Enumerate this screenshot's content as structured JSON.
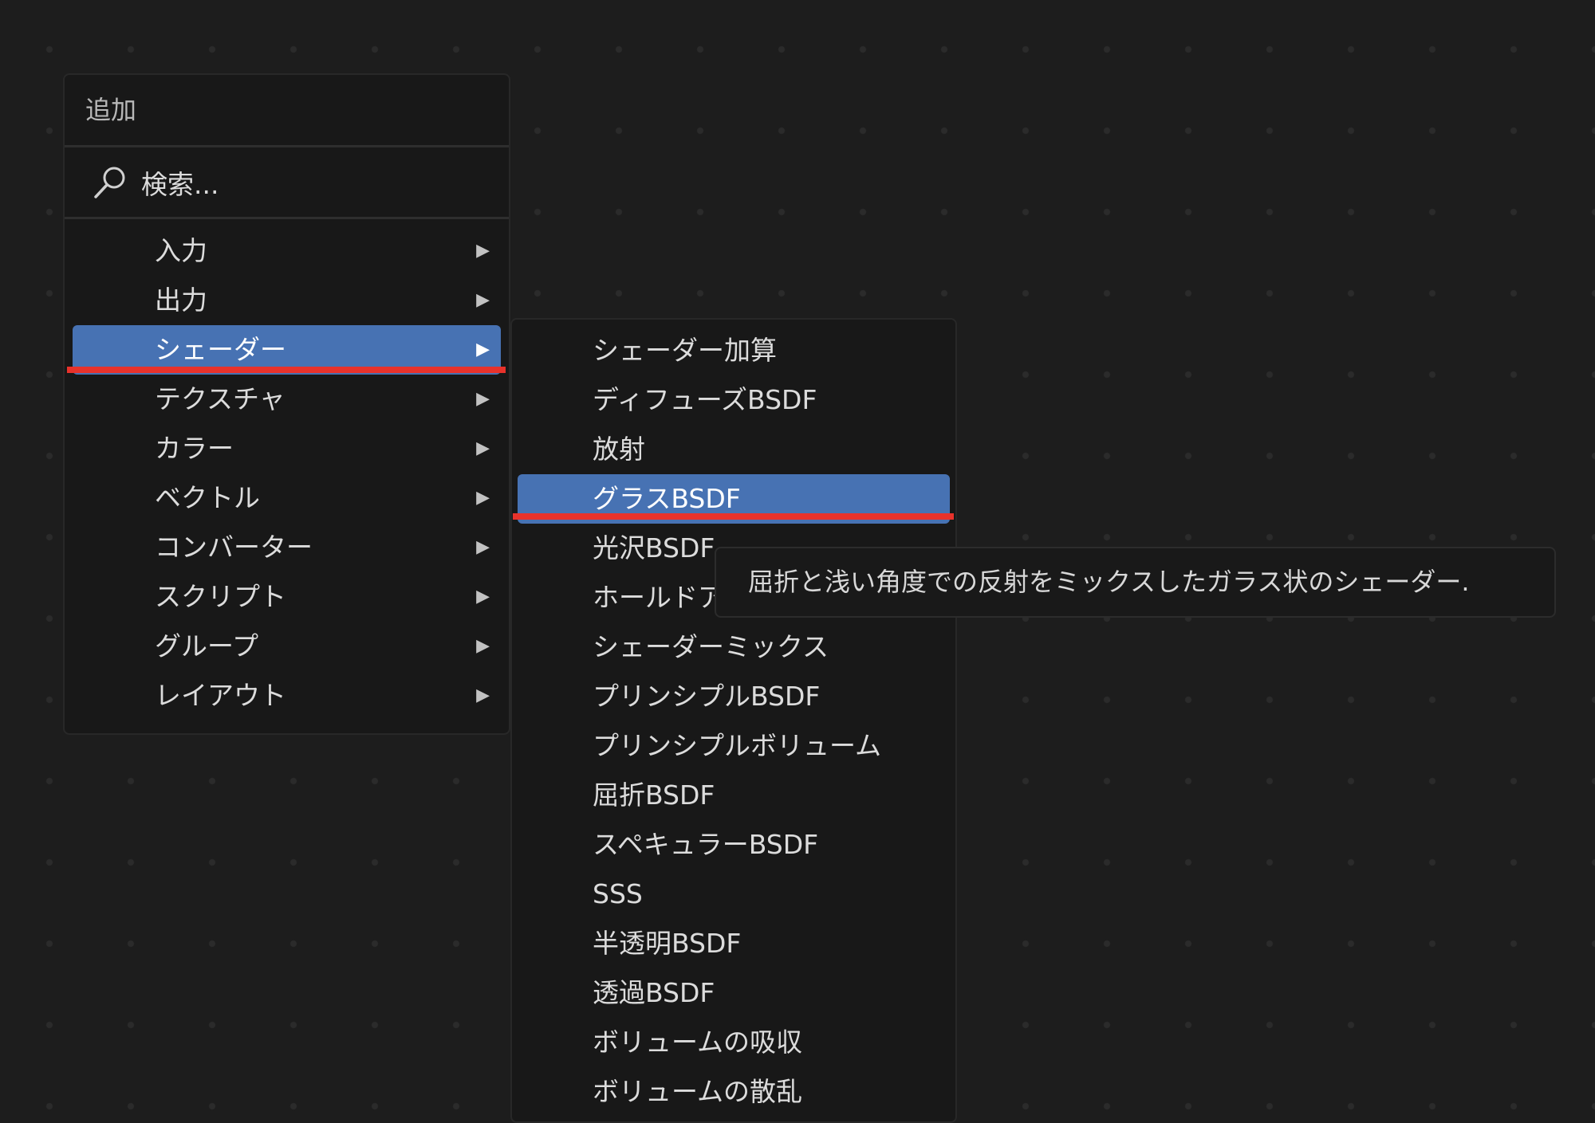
{
  "add_menu": {
    "title": "追加",
    "search_placeholder": "検索...",
    "items": [
      {
        "label": "入力",
        "has_submenu": true
      },
      {
        "label": "出力",
        "has_submenu": true
      },
      {
        "label": "シェーダー",
        "has_submenu": true,
        "active": true
      },
      {
        "label": "テクスチャ",
        "has_submenu": true
      },
      {
        "label": "カラー",
        "has_submenu": true
      },
      {
        "label": "ベクトル",
        "has_submenu": true
      },
      {
        "label": "コンバーター",
        "has_submenu": true
      },
      {
        "label": "スクリプト",
        "has_submenu": true
      },
      {
        "label": "グループ",
        "has_submenu": true
      },
      {
        "label": "レイアウト",
        "has_submenu": true
      }
    ],
    "submenu_arrow": "▶"
  },
  "shader_submenu": {
    "items": [
      {
        "label": "シェーダー加算"
      },
      {
        "label": "ディフューズBSDF"
      },
      {
        "label": "放射"
      },
      {
        "label": "グラスBSDF",
        "active": true
      },
      {
        "label": "光沢BSDF"
      },
      {
        "label": "ホールドアウト"
      },
      {
        "label": "シェーダーミックス"
      },
      {
        "label": "プリンシプルBSDF"
      },
      {
        "label": "プリンシプルボリューム"
      },
      {
        "label": "屈折BSDF"
      },
      {
        "label": "スペキュラーBSDF"
      },
      {
        "label": "SSS"
      },
      {
        "label": "半透明BSDF"
      },
      {
        "label": "透過BSDF"
      },
      {
        "label": "ボリュームの吸収"
      },
      {
        "label": "ボリュームの散乱"
      }
    ]
  },
  "tooltip": {
    "text": "屈折と浅い角度での反射をミックスしたガラス状のシェーダー."
  },
  "colors": {
    "background": "#1d1d1d",
    "menu_background": "#181818",
    "highlight": "#4772b3",
    "annotation_red": "#e8322b",
    "text": "#dcdcdc"
  },
  "icons": {
    "search": "search-icon",
    "submenu_arrow": "triangle-right-icon"
  }
}
